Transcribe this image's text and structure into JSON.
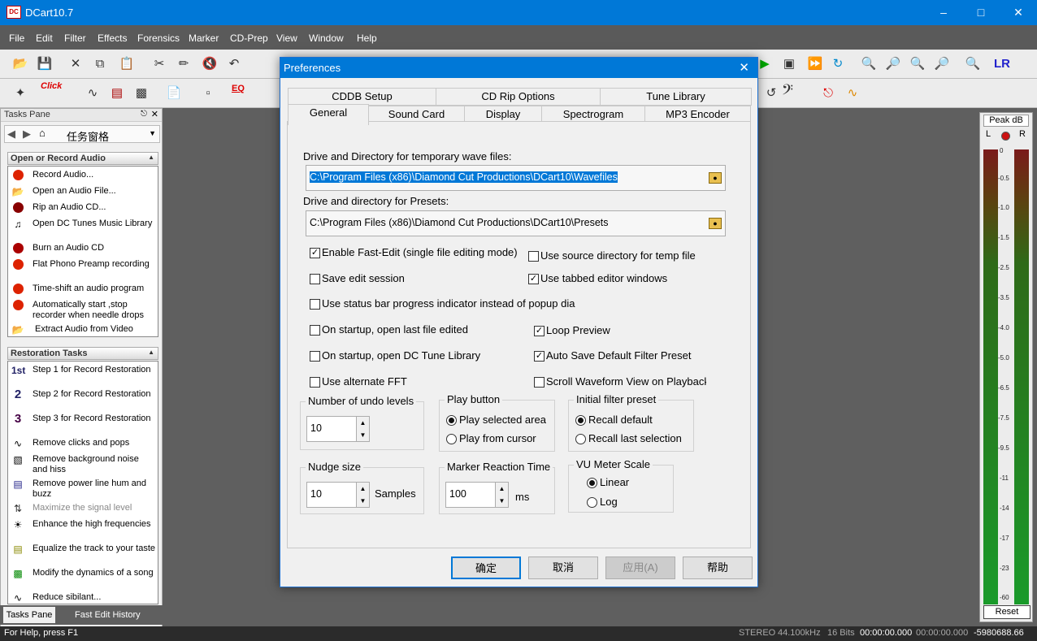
{
  "window": {
    "title": "DCart10.7"
  },
  "menu": [
    "File",
    "Edit",
    "Filter",
    "Effects",
    "Forensics",
    "Marker",
    "CD-Prep",
    "View",
    "Window",
    "Help"
  ],
  "taskpane": {
    "title": "Tasks Pane",
    "nav_label": "任务窗格",
    "section1_title": "Open or Record Audio",
    "section1_items": [
      "Record Audio...",
      "Open an Audio File...",
      "Rip an Audio CD...",
      "Open DC Tunes Music Library",
      "Burn an Audio CD",
      "Flat Phono Preamp recording",
      "Time-shift an audio program",
      "Automatically start ,stop recorder when needle drops",
      "Extract Audio from Video"
    ],
    "section2_title": "Restoration Tasks",
    "section2_items": [
      "Step 1 for Record Restoration",
      "Step 2 for Record Restoration",
      "Step 3 for Record Restoration",
      "Remove clicks and pops",
      "Remove background noise and hiss",
      "Remove power line hum and buzz",
      "Maximize the signal level",
      "Enhance the high frequencies",
      "Equalize the track to your taste",
      "Modify the dynamics of a song",
      "Reduce sibilant..."
    ],
    "bottom_tabs": [
      "Tasks Pane",
      "Fast Edit History"
    ]
  },
  "toolbar2": {
    "click_label": "Click",
    "eq_label": "EQ"
  },
  "vu": {
    "title": "Peak dB",
    "left": "L",
    "right": "R",
    "scale": [
      "0",
      "-0.5",
      "-1.0",
      "-1.5",
      "-2.5",
      "-3.5",
      "-4.0",
      "-5.0",
      "-6.5",
      "-7.5",
      "-9.5",
      "-11",
      "-14",
      "-17",
      "-23",
      "-60"
    ],
    "reset": "Reset"
  },
  "status": {
    "help": "For Help, press F1",
    "format": "STEREO",
    "rate": "44.100kHz",
    "bits": "16 Bits",
    "time1": "00:00:00.000",
    "time2": "00:00:00.000",
    "samples": "-5980688.66"
  },
  "dialog": {
    "title": "Preferences",
    "tabs_back": [
      "CDDB Setup",
      "CD Rip Options",
      "Tune Library"
    ],
    "tabs_front": [
      "General",
      "Sound Card",
      "Display",
      "Spectrogram",
      "MP3 Encoder"
    ],
    "temp_label": "Drive and Directory for temporary wave files:",
    "temp_path": "C:\\Program Files (x86)\\Diamond Cut Productions\\DCart10\\Wavefiles",
    "preset_label": "Drive and directory for Presets:",
    "preset_path": "C:\\Program Files (x86)\\Diamond Cut Productions\\DCart10\\Presets",
    "checks": [
      {
        "label": "Enable Fast-Edit (single file editing mode)",
        "checked": true
      },
      {
        "label": "Use source directory for temp file",
        "checked": false
      },
      {
        "label": "Save edit session",
        "checked": false
      },
      {
        "label": "Use tabbed editor windows",
        "checked": true
      },
      {
        "label": "Use status bar progress indicator instead of popup dia",
        "checked": false
      },
      {
        "label": "On startup, open last file edited",
        "checked": false
      },
      {
        "label": "Loop Preview",
        "checked": true
      },
      {
        "label": "On startup, open DC Tune Library",
        "checked": false
      },
      {
        "label": "Auto Save Default Filter Preset",
        "checked": true
      },
      {
        "label": "Use alternate FFT",
        "checked": false
      },
      {
        "label": "Scroll Waveform View on Playback",
        "checked": false
      }
    ],
    "undo_title": "Number of undo levels",
    "undo_value": "10",
    "play_title": "Play button",
    "play_opt1": "Play selected area",
    "play_opt2": "Play from cursor",
    "filter_title": "Initial filter preset",
    "filter_opt1": "Recall default",
    "filter_opt2": "Recall last selection",
    "nudge_title": "Nudge size",
    "nudge_value": "10",
    "nudge_unit": "Samples",
    "marker_title": "Marker Reaction Time",
    "marker_value": "100",
    "marker_unit": "ms",
    "vu_title": "VU Meter Scale",
    "vu_opt1": "Linear",
    "vu_opt2": "Log",
    "buttons": {
      "ok": "确定",
      "cancel": "取消",
      "apply": "应用(A)",
      "help": "帮助"
    }
  }
}
